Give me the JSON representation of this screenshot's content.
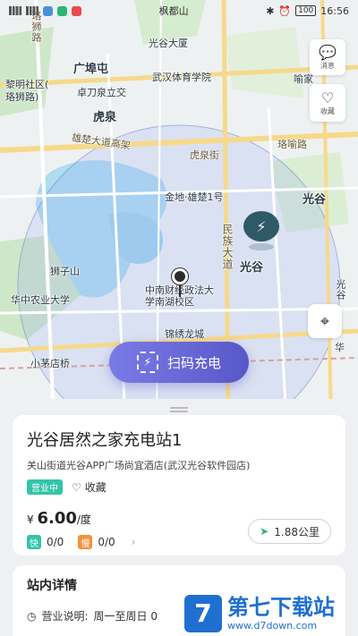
{
  "status_bar": {
    "location": "枫都山",
    "battery": "100",
    "time": "16:56"
  },
  "map": {
    "labels": {
      "luoshi_road": "珞狮路",
      "guangxi_park": "广埠屯",
      "liming_community": "黎明社区(",
      "luoshi_road_2": "珞狮路)",
      "zhuodaoquan": "卓刀泉立交",
      "wuhan_gym": "武汉体育学院",
      "guanggu_dasha": "光谷大厦",
      "huquan": "虎泉",
      "huquan_street": "虎泉街",
      "xiongchu_avenue": "雄楚大道高架",
      "luoyu_road": "珞喻路",
      "jindi": "金地·雄楚1号",
      "guanggu": "光谷",
      "guanggu_2": "光谷",
      "minzu_avenue": "民族大道",
      "shizi_mountain": "狮子山",
      "huazhong_agri": "华中农业大学",
      "zhongnan_univ": "中南财经政法大学南湖校区",
      "jinxiu": "锦绣龙城",
      "xiaomaodian": "小茅店桥",
      "guanggu_3": "光谷",
      "yuhe": "喻家",
      "huaqiao": "华"
    }
  },
  "tools": {
    "message": {
      "label": "消息",
      "icon": "message-icon"
    },
    "favorite": {
      "label": "收藏",
      "icon": "heart-icon"
    }
  },
  "scan_button": {
    "label": "扫码充电",
    "icon": "scan-charge-icon"
  },
  "station": {
    "name": "光谷居然之家充电站1",
    "address": "关山街道光谷APP广场尚宜酒店(武汉光谷软件园店)",
    "status": "营业中",
    "favorite_label": "收藏",
    "price_currency": "¥",
    "price_value": "6.00",
    "price_unit": "/度",
    "fast_label": "快",
    "fast_count": "0/0",
    "slow_label": "慢",
    "slow_count": "0/0",
    "distance": "1.88公里",
    "colors": {
      "accent": "#6c6ce0",
      "status": "#31c4a9",
      "fast": "#31c4a9",
      "slow": "#f5913a"
    }
  },
  "details": {
    "title": "站内详情",
    "hours_label": "营业说明:",
    "hours_value": "周一至周日 0"
  },
  "watermark": {
    "logo_char": "7",
    "name": "第七下载站",
    "url": "www.d7down.com"
  }
}
